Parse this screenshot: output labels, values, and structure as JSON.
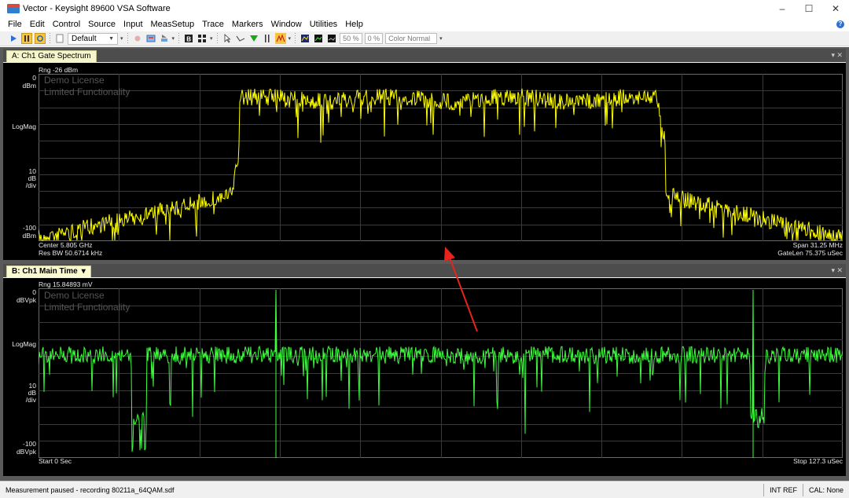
{
  "window": {
    "title": "Vector - Keysight 89600 VSA Software",
    "minimize": "–",
    "maximize": "☐",
    "close": "✕"
  },
  "menu": [
    "File",
    "Edit",
    "Control",
    "Source",
    "Input",
    "MeasSetup",
    "Trace",
    "Markers",
    "Window",
    "Utilities",
    "Help"
  ],
  "toolbar": {
    "preset": "Default",
    "percent_a": "50 %",
    "percent_b": "0 %",
    "color_scheme": "Color Normal"
  },
  "pane_a": {
    "tab_label": "A: Ch1 Gate Spectrum",
    "range": "Rng -26 dBm",
    "top_value": "0",
    "top_unit": "dBm",
    "scale_type": "LogMag",
    "scale_div_value": "10",
    "scale_div_unit1": "dB",
    "scale_div_unit2": "/div",
    "bottom_value": "-100",
    "bottom_unit": "dBm",
    "center": "Center 5.805 GHz",
    "res_bw": "Res BW 50.6714 kHz",
    "span": "Span 31.25 MHz",
    "gate_len": "GateLen 75.375 uSec",
    "watermark_1": "Demo License",
    "watermark_2": "Limited Functionality",
    "trace_color": "#ffff00"
  },
  "pane_b": {
    "tab_label": "B: Ch1 Main Time",
    "tab_dropdown": "▾",
    "range": "Rng 15.84893 mV",
    "top_value": "0",
    "top_unit": "dBVpk",
    "scale_type": "LogMag",
    "scale_div_value": "10",
    "scale_div_unit1": "dB",
    "scale_div_unit2": "/div",
    "bottom_value": "-100",
    "bottom_unit": "dBVpk",
    "start": "Start 0  Sec",
    "stop": "Stop 127.3 uSec",
    "watermark_1": "Demo License",
    "watermark_2": "Limited Functionality",
    "trace_color": "#3cff3c"
  },
  "pane_controls": "▾ ✕",
  "annotation": {
    "arrow_color": "#e8231c"
  },
  "status": {
    "message": "Measurement paused - recording 80211a_64QAM.sdf",
    "ref": "INT REF",
    "cal": "CAL: None"
  },
  "icons": [
    "play-icon",
    "pause-icon",
    "restart-icon",
    "record-icon",
    "marker-icon",
    "pointer-icon",
    "color-icon"
  ]
}
